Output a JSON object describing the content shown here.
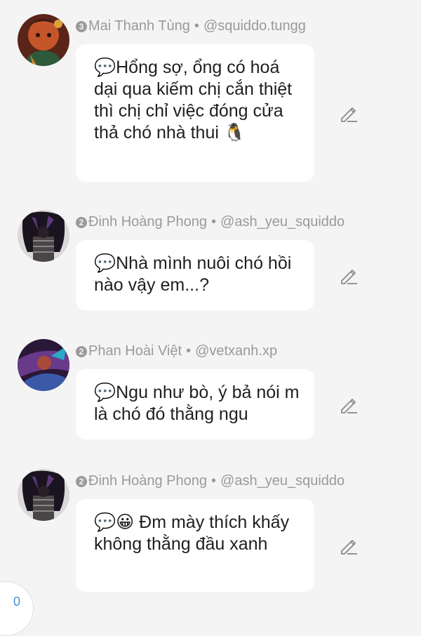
{
  "comments": [
    {
      "rank": "3",
      "name": "Mai Thanh Tùng",
      "separator": "•",
      "handle": "@squiddo.tungg",
      "text": "💬Hổng sợ, ổng có hoá dại qua kiếm chị cắn thiệt thì chị chỉ việc đóng cửa thả chó nhà thui 🐧",
      "avatar": "avatar-orange-art",
      "edit_icon": "pencil-icon"
    },
    {
      "rank": "2",
      "name": "Đinh Hoàng Phong",
      "separator": "•",
      "handle": "@ash_yeu_squiddo",
      "text": "💬Nhà mình nuôi chó hồi nào vậy em...?",
      "avatar": "avatar-dark-figure",
      "edit_icon": "pencil-icon"
    },
    {
      "rank": "2",
      "name": "Phan Hoài Việt",
      "separator": "•",
      "handle": "@vetxanh.xp",
      "text": "💬Ngu như bò, ý bả nói m là chó đó thằng ngu",
      "avatar": "avatar-purple-art",
      "edit_icon": "pencil-icon"
    },
    {
      "rank": "2",
      "name": "Đinh Hoàng Phong",
      "separator": "•",
      "handle": "@ash_yeu_squiddo",
      "text": "💬😀 Đm mày thích khấy không thằng đầu xanh",
      "avatar": "avatar-dark-figure",
      "edit_icon": "pencil-icon"
    }
  ],
  "counter": {
    "value": "0"
  },
  "colors": {
    "background": "#f4f4f4",
    "bubble": "#ffffff",
    "meta_text": "#9a9a9a",
    "body_text": "#1f1f1f",
    "counter_text": "#4a90d9"
  }
}
